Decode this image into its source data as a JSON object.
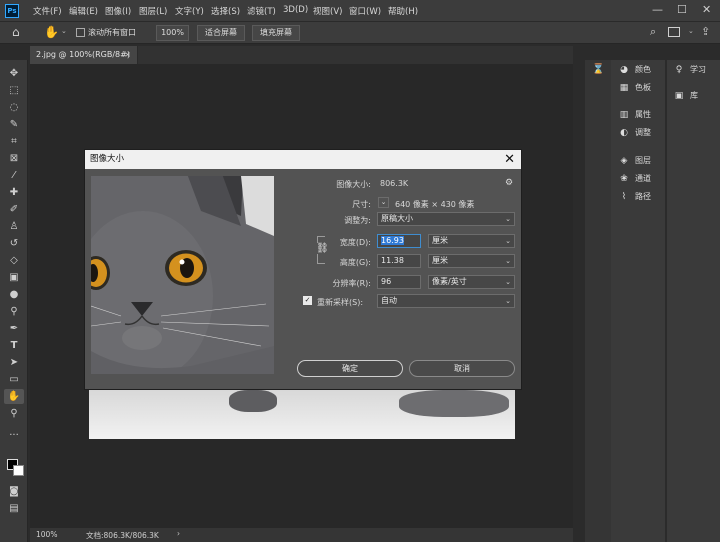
{
  "app": {
    "logo": "Ps"
  },
  "menu": [
    "文件(F)",
    "编辑(E)",
    "图像(I)",
    "图层(L)",
    "文字(Y)",
    "选择(S)",
    "滤镜(T)",
    "3D(D)",
    "视图(V)",
    "窗口(W)",
    "帮助(H)"
  ],
  "window_controls": {
    "minimize": "—",
    "maximize": "☐",
    "close": "✕"
  },
  "options": {
    "scroll_all": "滚动所有窗口",
    "zoom": "100%",
    "fit_screen": "适合屏幕",
    "fill_screen": "填充屏幕"
  },
  "document": {
    "tab": "2.jpg @ 100%(RGB/8#)",
    "close": "×"
  },
  "status": {
    "zoom": "100%",
    "doc": "文档:806.3K/806.3K",
    "arrow": "›"
  },
  "panels": {
    "group1": [
      {
        "icon": "palette-icon",
        "label": "颜色"
      },
      {
        "icon": "swatches-icon",
        "label": "色板"
      },
      {
        "icon": "properties-icon",
        "label": "属性"
      },
      {
        "icon": "adjustments-icon",
        "label": "调整"
      },
      {
        "icon": "layers-icon",
        "label": "图层"
      },
      {
        "icon": "channels-icon",
        "label": "通道"
      },
      {
        "icon": "paths-icon",
        "label": "路径"
      }
    ],
    "group2": [
      {
        "icon": "learn-icon",
        "label": "学习"
      },
      {
        "icon": "libraries-icon",
        "label": "库"
      }
    ]
  },
  "dialog": {
    "title": "图像大小",
    "close": "✕",
    "image_size_label": "图像大小:",
    "image_size_value": "806.3K",
    "dimensions_label": "尺寸:",
    "dimensions_value": "640 像素 × 430 像素",
    "fit_to_label": "调整为:",
    "fit_to_value": "原稿大小",
    "width_label": "宽度(D):",
    "width_value": "16.93",
    "width_unit": "厘米",
    "height_label": "高度(G):",
    "height_value": "11.38",
    "height_unit": "厘米",
    "resolution_label": "分辨率(R):",
    "resolution_value": "96",
    "resolution_unit": "像素/英寸",
    "resample_label": "重新采样(S):",
    "resample_value": "自动",
    "resample_checked": true,
    "ok": "确定",
    "cancel": "取消"
  },
  "colors": {
    "accent": "#31a8ff",
    "ui_dark": "#3c3c3c",
    "dialog_bg": "#535353",
    "cat_eye": "#d18a1d"
  }
}
